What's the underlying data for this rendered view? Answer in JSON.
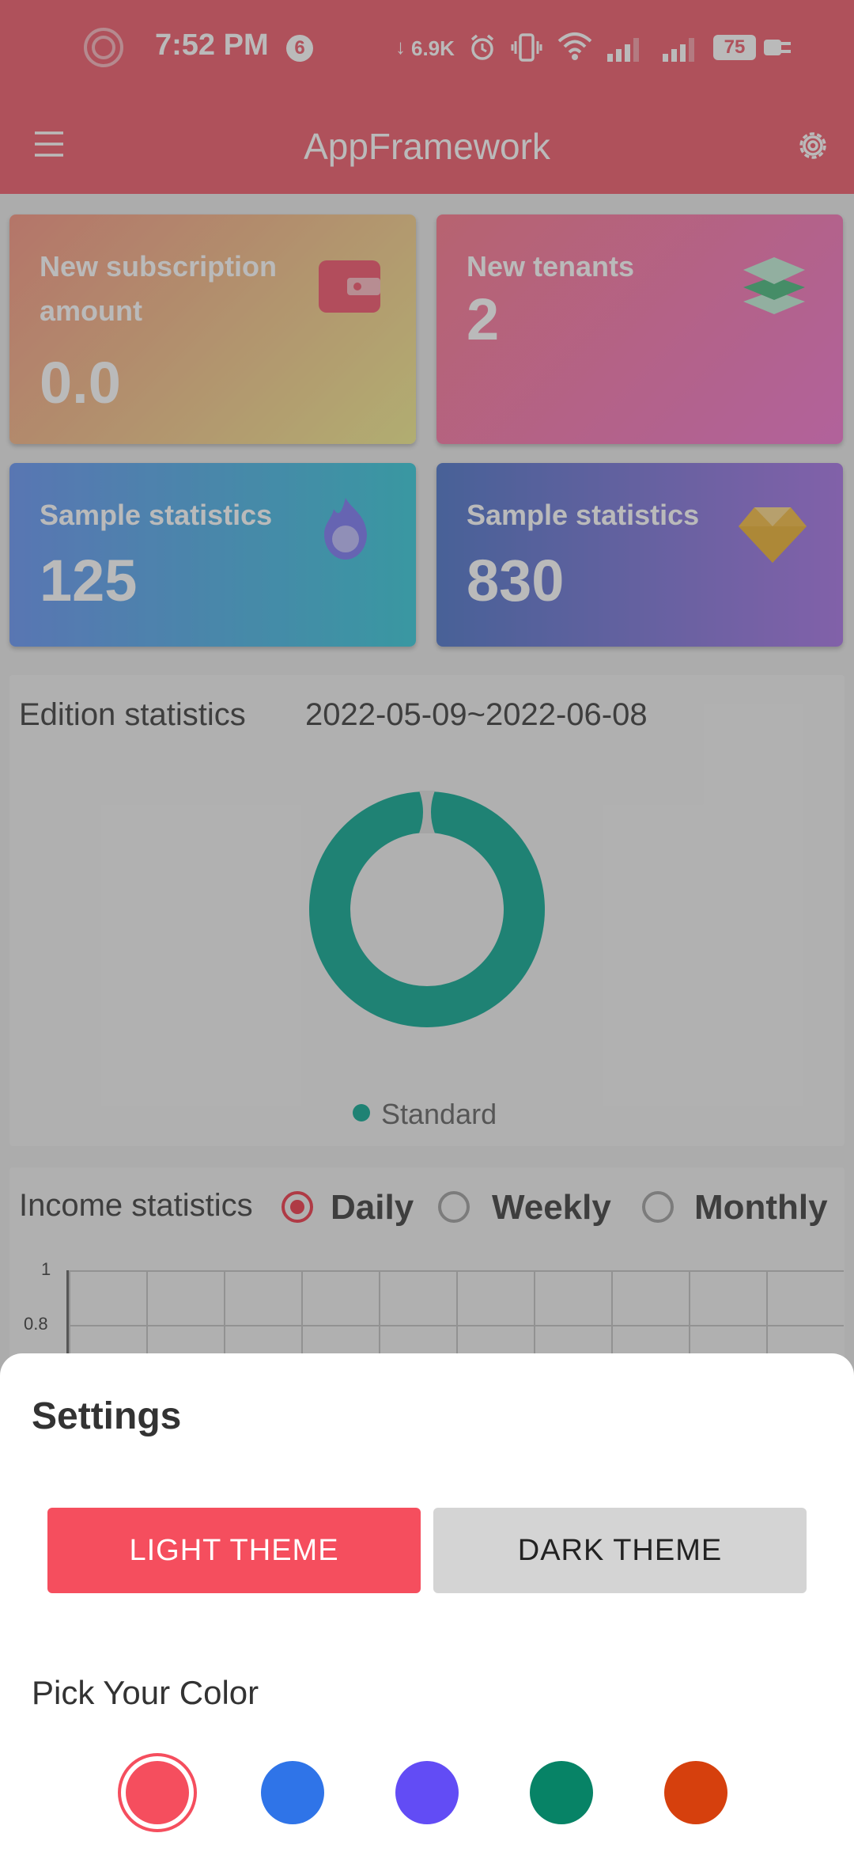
{
  "status_bar": {
    "time": "7:52 PM",
    "notification_count": "6",
    "network_speed": "6.9K",
    "battery_level": "75",
    "icons": [
      "recording-icon",
      "download-arrow-icon",
      "alarm-icon",
      "vibrate-icon",
      "wifi-icon",
      "signal-icon",
      "signal-icon",
      "battery-icon",
      "charging-icon"
    ]
  },
  "app_bar": {
    "title": "AppFramework",
    "menu_icon": "hamburger-menu-icon",
    "settings_icon": "gear-icon"
  },
  "stat_cards": [
    {
      "title_line1": "New subscription",
      "title_line2": "amount",
      "value": "0.0",
      "icon": "wallet-icon"
    },
    {
      "title": "New tenants",
      "value": "2",
      "icon": "layers-icon"
    },
    {
      "title": "Sample statistics",
      "value": "125",
      "icon": "flame-icon"
    },
    {
      "title": "Sample statistics",
      "value": "830",
      "icon": "diamond-icon"
    }
  ],
  "edition_statistics": {
    "title": "Edition statistics",
    "date_range": "2022-05-09~2022-06-08",
    "legend": "Standard",
    "chart_data": {
      "type": "pie",
      "categories": [
        "Standard"
      ],
      "values": [
        1
      ],
      "colors": [
        "#2bb3a0"
      ]
    }
  },
  "income_statistics": {
    "title": "Income statistics",
    "options": [
      {
        "label": "Daily",
        "selected": true
      },
      {
        "label": "Weekly",
        "selected": false
      },
      {
        "label": "Monthly",
        "selected": false
      }
    ],
    "y_ticks": [
      "1",
      "0.8"
    ]
  },
  "settings_sheet": {
    "title": "Settings",
    "light_theme_label": "LIGHT THEME",
    "dark_theme_label": "DARK THEME",
    "pick_color_label": "Pick Your Color",
    "colors": [
      "#f54e5e",
      "#2f74e8",
      "#624cf5",
      "#078366",
      "#d6400d"
    ],
    "selected_color": "#f54e5e"
  }
}
